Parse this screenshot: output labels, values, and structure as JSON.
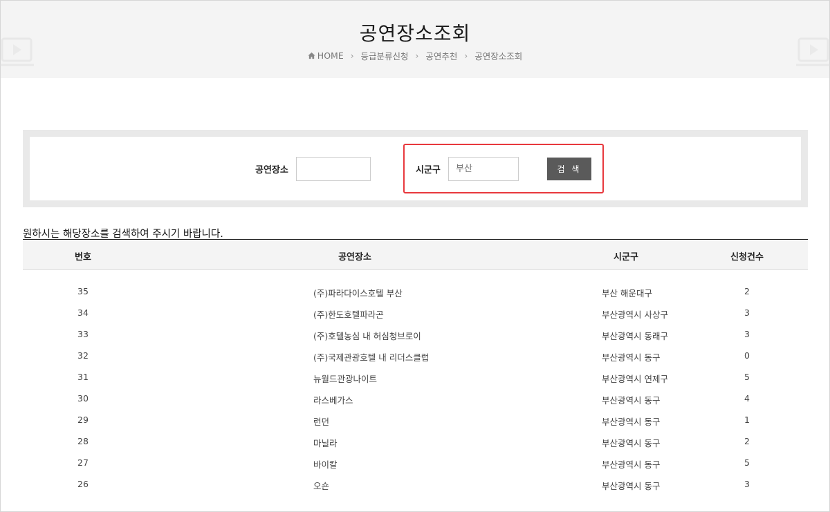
{
  "header": {
    "title": "공연장소조회",
    "breadcrumb": [
      "HOME",
      "등급분류신청",
      "공연추천",
      "공연장소조회"
    ]
  },
  "search": {
    "venue_label": "공연장소",
    "venue_value": "",
    "district_label": "시군구",
    "district_placeholder": "부산",
    "button_label": "검 색"
  },
  "notice": "원하시는 해당장소를 검색하여 주시기 바랍니다.",
  "table": {
    "columns": [
      "번호",
      "공연장소",
      "시군구",
      "신청건수"
    ],
    "rows": [
      {
        "num": "35",
        "venue": "(주)파라다이스호텔 부산",
        "district": "부산 해운대구",
        "count": "2"
      },
      {
        "num": "34",
        "venue": "(주)한도호텔파라곤",
        "district": "부산광역시 사상구",
        "count": "3"
      },
      {
        "num": "33",
        "venue": "(주)호텔농심 내 허심청브로이",
        "district": "부산광역시 동래구",
        "count": "3"
      },
      {
        "num": "32",
        "venue": "(주)국제관광호텔 내 리더스클럽",
        "district": "부산광역시 동구",
        "count": "0"
      },
      {
        "num": "31",
        "venue": "뉴월드관광나이트",
        "district": "부산광역시 연제구",
        "count": "5"
      },
      {
        "num": "30",
        "venue": "라스베가스",
        "district": "부산광역시 동구",
        "count": "4"
      },
      {
        "num": "29",
        "venue": "런던",
        "district": "부산광역시 동구",
        "count": "1"
      },
      {
        "num": "28",
        "venue": "마닐라",
        "district": "부산광역시 동구",
        "count": "2"
      },
      {
        "num": "27",
        "venue": "바이칼",
        "district": "부산광역시 동구",
        "count": "5"
      },
      {
        "num": "26",
        "venue": "오숀",
        "district": "부산광역시 동구",
        "count": "3"
      }
    ]
  },
  "colors": {
    "highlight": "#e8383d",
    "button": "#5a5a5a",
    "header_bg": "#f4f4f4"
  }
}
